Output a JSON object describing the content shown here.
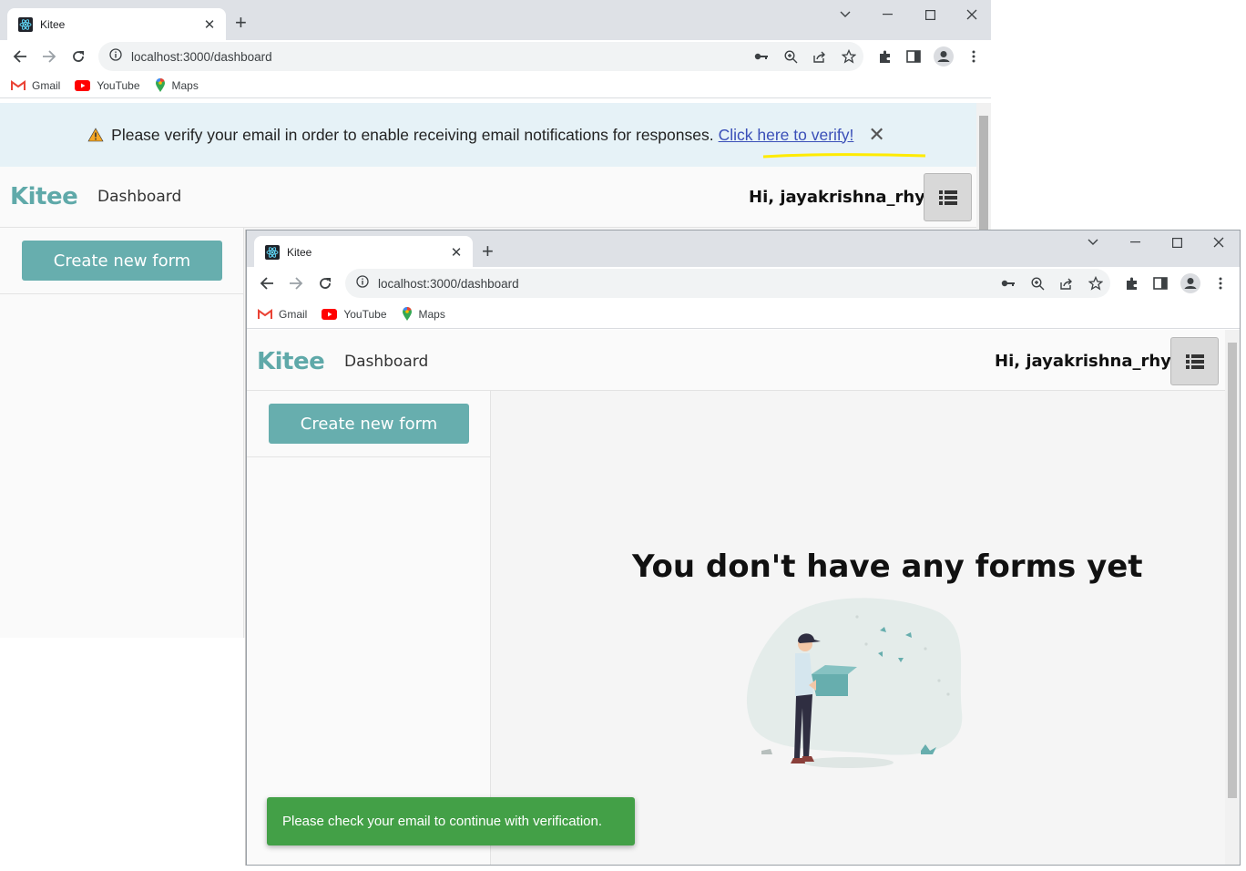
{
  "browser": {
    "tab_title": "Kitee",
    "url": "localhost:3000/dashboard",
    "bookmarks": [
      {
        "label": "Gmail",
        "icon": "gmail-icon"
      },
      {
        "label": "YouTube",
        "icon": "youtube-icon"
      },
      {
        "label": "Maps",
        "icon": "maps-icon"
      }
    ]
  },
  "banner": {
    "message": "Please verify your email in order to enable receiving email notifications for responses.",
    "link": "Click here to verify!",
    "highlight_color": "#ffeb00"
  },
  "app": {
    "brand": "Kitee",
    "nav_link": "Dashboard",
    "greeting": "Hi, jayakrishna_rhy",
    "create_button": "Create new form",
    "empty_title": "You don't have any forms yet",
    "brand_color": "#5fa9a9",
    "button_color": "#67aeae"
  },
  "toast": {
    "message": "Please check your email to continue with verification.",
    "color": "#43a047"
  }
}
